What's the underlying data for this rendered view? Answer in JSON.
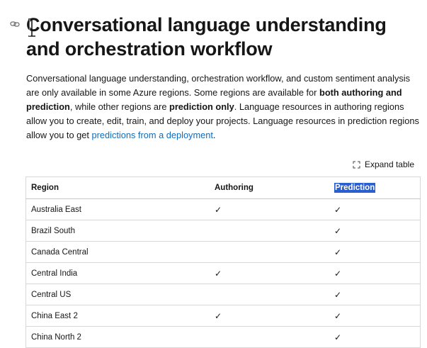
{
  "heading": {
    "title": "Conversational language understanding and orchestration workflow",
    "anchor_icon": "link-icon"
  },
  "intro": {
    "part1": "Conversational language understanding, orchestration workflow, and custom sentiment analysis are only available in some Azure regions. Some regions are available for ",
    "bold1": "both authoring and prediction",
    "part2": ", while other regions are ",
    "bold2": "prediction only",
    "part3": ". Language resources in authoring regions allow you to create, edit, train, and deploy your projects. Language resources in prediction regions allow you to get ",
    "link": "predictions from a deployment",
    "part4": "."
  },
  "toolbar": {
    "expand_label": "Expand table",
    "expand_icon": "expand-icon"
  },
  "table": {
    "headers": [
      "Region",
      "Authoring",
      "Prediction"
    ],
    "selected_header_color": "#2b5fd0",
    "rows": [
      {
        "region": "Australia East",
        "authoring": "✓",
        "prediction": "✓"
      },
      {
        "region": "Brazil South",
        "authoring": "",
        "prediction": "✓"
      },
      {
        "region": "Canada Central",
        "authoring": "",
        "prediction": "✓"
      },
      {
        "region": "Central India",
        "authoring": "✓",
        "prediction": "✓"
      },
      {
        "region": "Central US",
        "authoring": "",
        "prediction": "✓"
      },
      {
        "region": "China East 2",
        "authoring": "✓",
        "prediction": "✓"
      },
      {
        "region": "China North 2",
        "authoring": "",
        "prediction": "✓"
      }
    ]
  },
  "colors": {
    "link": "#0f6cbd",
    "text": "#161616",
    "border": "#d8d8d8"
  }
}
